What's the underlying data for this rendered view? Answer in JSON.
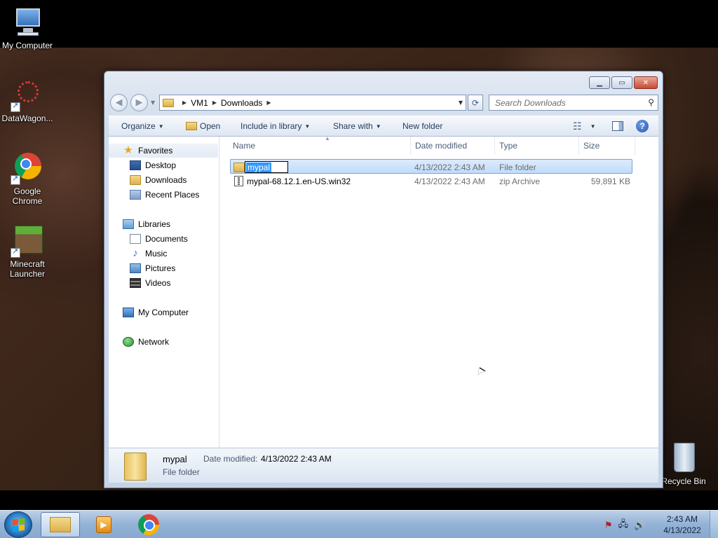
{
  "desktop": {
    "icons": [
      {
        "label": "My Computer"
      },
      {
        "label": "DataWagon..."
      },
      {
        "label": "Google Chrome"
      },
      {
        "label": "Minecraft Launcher"
      },
      {
        "label": "Recycle Bin"
      }
    ]
  },
  "window": {
    "address": {
      "crumbs": [
        "VM1",
        "Downloads"
      ]
    },
    "search": {
      "placeholder": "Search Downloads"
    },
    "toolbar": {
      "organize": "Organize",
      "open": "Open",
      "include_in_library": "Include in library",
      "share_with": "Share with",
      "new_folder": "New folder"
    },
    "nav_pane": {
      "favorites": {
        "label": "Favorites",
        "items": [
          "Desktop",
          "Downloads",
          "Recent Places"
        ]
      },
      "libraries": {
        "label": "Libraries",
        "items": [
          "Documents",
          "Music",
          "Pictures",
          "Videos"
        ]
      },
      "computer": "My Computer",
      "network": "Network"
    },
    "columns": [
      "Name",
      "Date modified",
      "Type",
      "Size"
    ],
    "files": [
      {
        "name": "mypal",
        "date": "4/13/2022 2:43 AM",
        "type": "File folder",
        "size": "",
        "renaming": true
      },
      {
        "name": "mypal-68.12.1.en-US.win32",
        "date": "4/13/2022 2:43 AM",
        "type": "zip Archive",
        "size": "59,891 KB",
        "renaming": false
      }
    ],
    "details": {
      "name": "mypal",
      "type": "File folder",
      "date_label": "Date modified:",
      "date_value": "4/13/2022 2:43 AM"
    }
  },
  "taskbar": {
    "clock": {
      "time": "2:43 AM",
      "date": "4/13/2022"
    }
  }
}
